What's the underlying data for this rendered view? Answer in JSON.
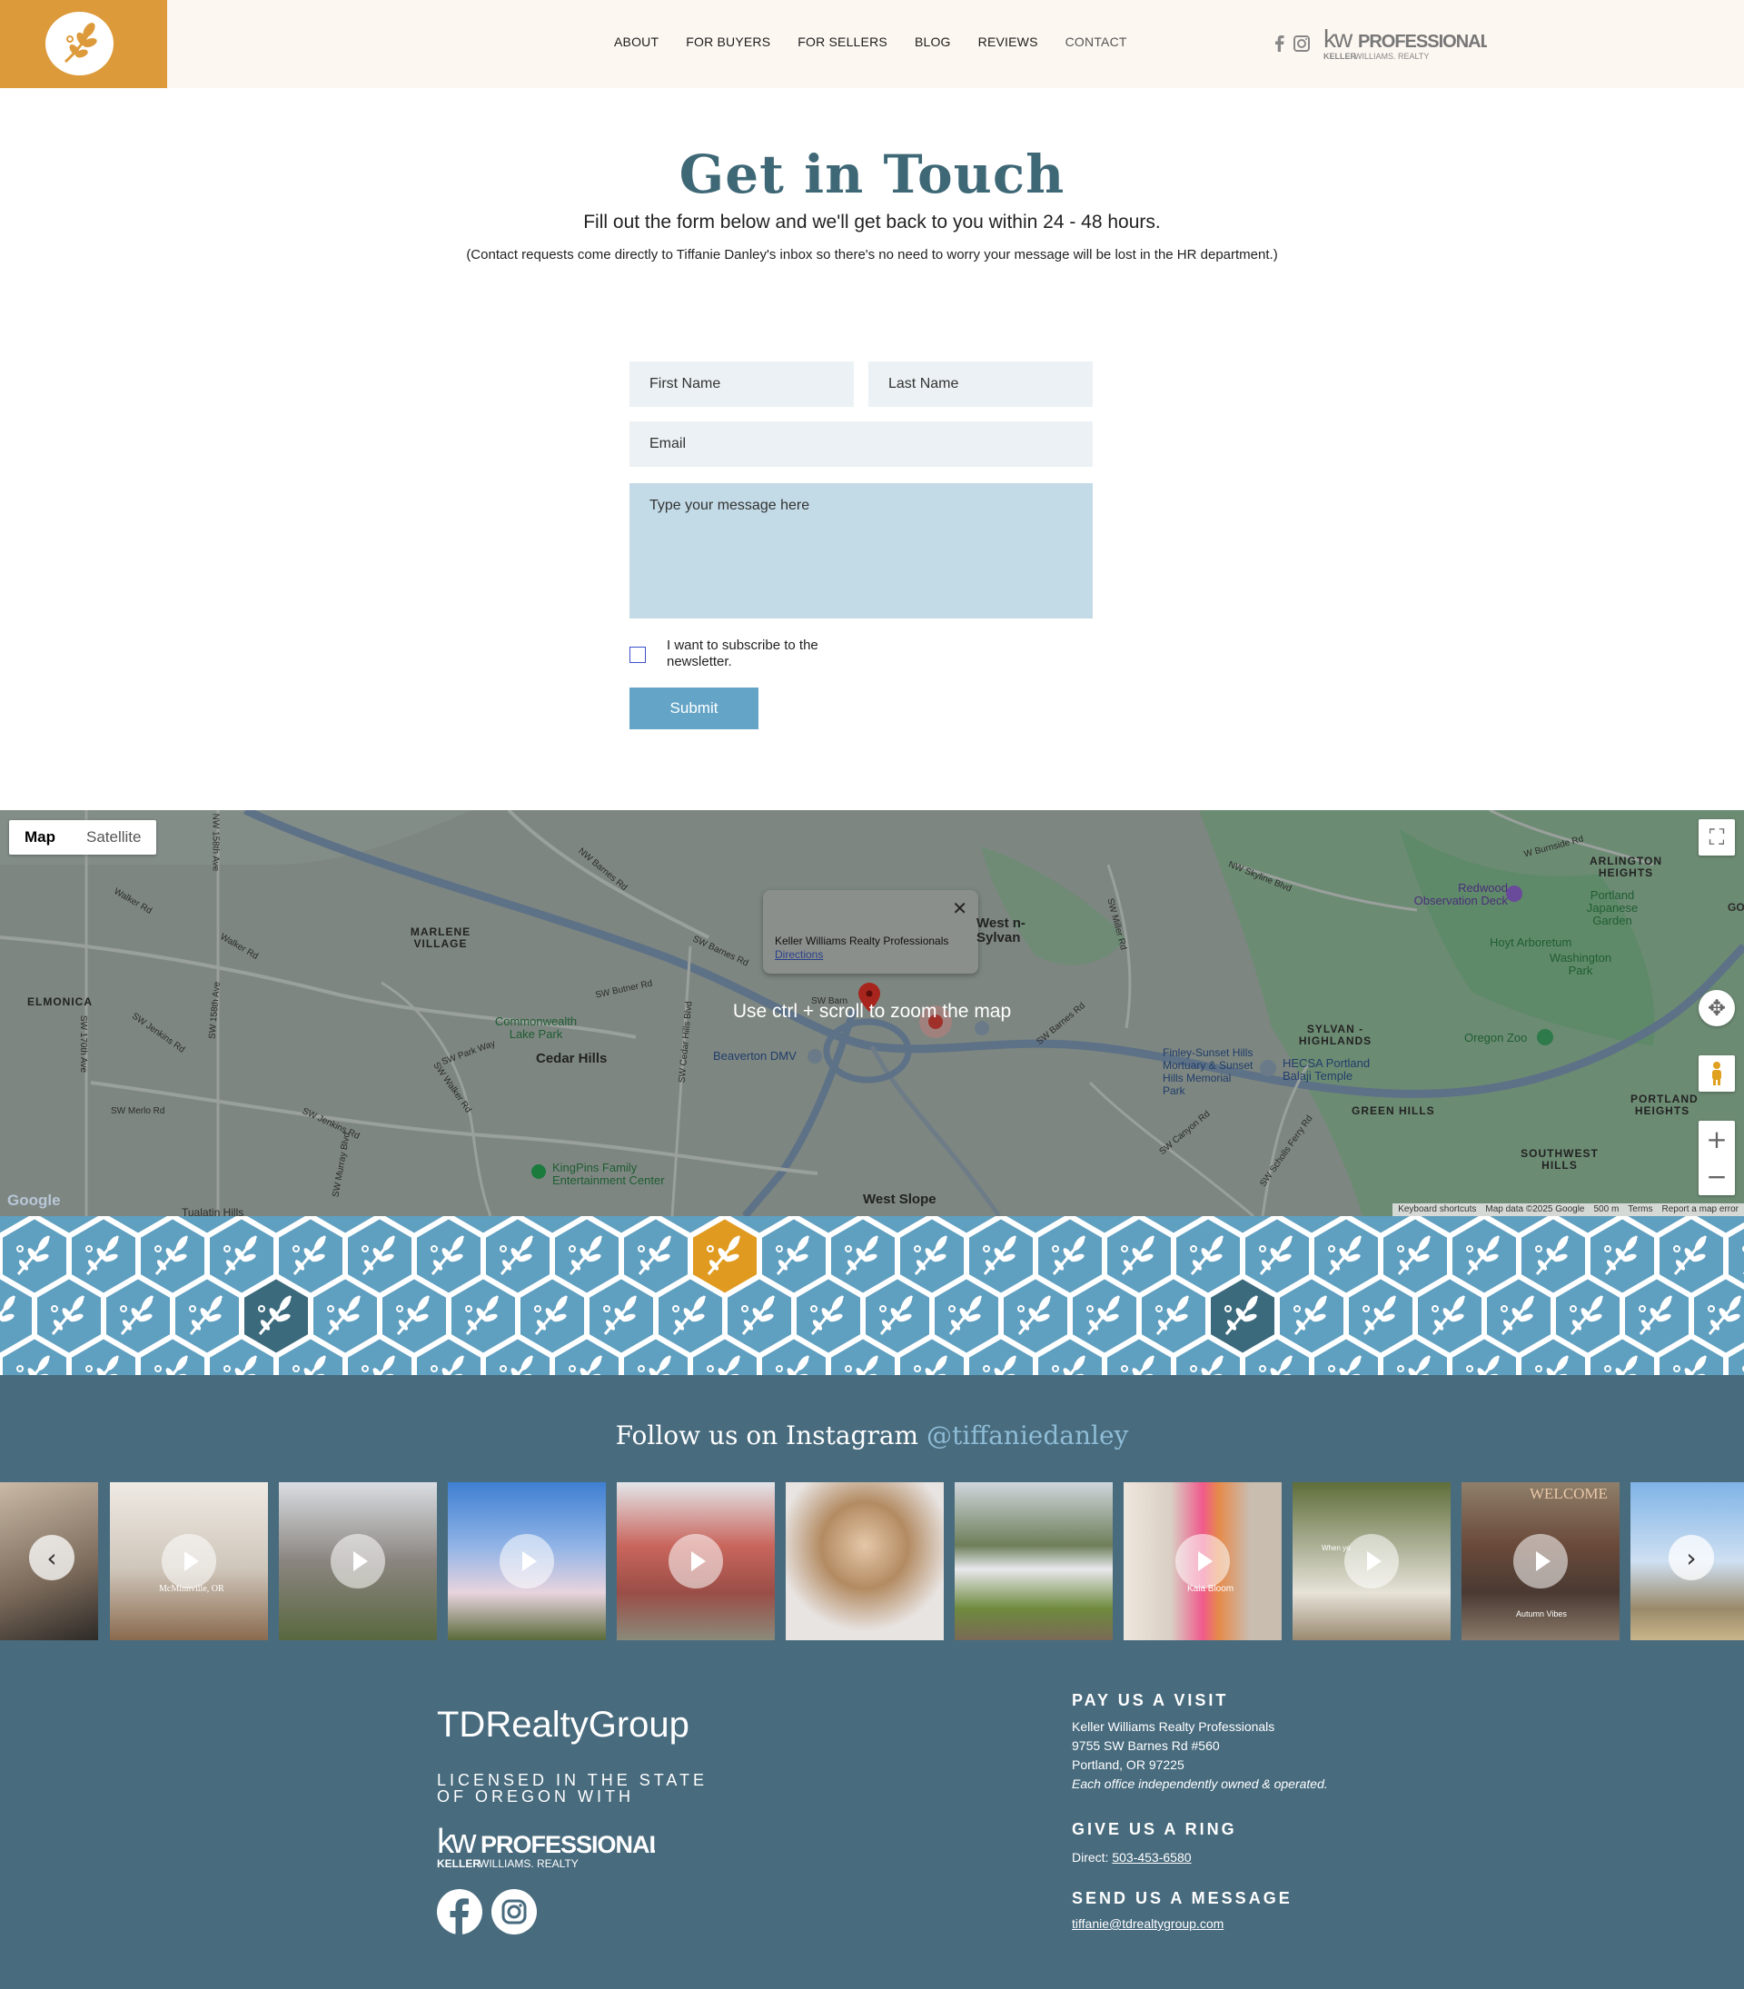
{
  "colors": {
    "accent_gold": "#dd9a3a",
    "title_teal": "#3f6877",
    "footer_bg": "#486b7e",
    "button_blue": "#64a5c7",
    "message_bg": "#c3dbe7"
  },
  "header": {
    "logo_icon": "olive-branch-icon",
    "nav": [
      "ABOUT",
      "FOR BUYERS",
      "FOR SELLERS",
      "BLOG",
      "REVIEWS",
      "CONTACT"
    ],
    "kw": {
      "mark": "kw",
      "name": "PROFESSIONALS",
      "sub_bold": "KELLER",
      "sub_rest": "WILLIAMS. REALTY"
    }
  },
  "contact": {
    "title": "Get in Touch",
    "subtitle": "Fill out the form below and we'll get back to you within 24 - 48 hours.",
    "note": "(Contact requests come directly to Tiffanie Danley's inbox so there's no need to worry your message will be lost in the HR department.)",
    "first_name_placeholder": "First Name",
    "last_name_placeholder": "Last Name",
    "email_placeholder": "Email",
    "message_placeholder": "Type your message here",
    "subscribe_label": "I want to subscribe to the newsletter.",
    "submit_label": "Submit"
  },
  "map": {
    "tab_map": "Map",
    "tab_satellite": "Satellite",
    "info_name": "Keller Williams Realty Professionals",
    "info_directions": "Directions",
    "hint": "Use ctrl + scroll to zoom the map",
    "labels": {
      "marlene": "MARLENE VILLAGE",
      "elmonica": "ELMONICA",
      "commonwealth": "Commonwealth Lake Park",
      "cedar_hills": "Cedar Hills",
      "beaverton_dmv": "Beaverton DMV",
      "west_sylvan": "West n-Sylvan",
      "sylvan_highlands": "SYLVAN - HIGHLANDS",
      "arlington": "ARLINGTON HEIGHTS",
      "redwood": "Redwood Observation Deck",
      "japanese_garden": "Portland Japanese Garden",
      "hoyt": "Hoyt Arboretum",
      "washington_park": "Washington Park",
      "oregon_zoo": "Oregon Zoo",
      "finley": "Finley-Sunset Hills Mortuary & Sunset Hills Memorial Park",
      "hecsa": "HECSA Portland Balaji Temple",
      "green_hills": "GREEN HILLS",
      "portland_heights": "PORTLAND HEIGHTS",
      "southwest_hills": "SOUTHWEST HILLS",
      "kingpins": "KingPins Family Entertainment Center",
      "west_slope": "West Slope",
      "tualatin": "Tualatin Hills",
      "walker_rd": "Walker Rd",
      "sw_barnes": "SW Barnes Rd",
      "nw_barnes": "NW Barnes Rd",
      "sw_butner": "SW Butner Rd",
      "sw_merlo": "SW Merlo Rd",
      "sw_jenkins": "SW Jenkins Rd",
      "sw_park_way": "SW Park Way",
      "nw_skyline": "NW Skyline Blvd",
      "sw_canyon": "SW Canyon Rd",
      "sw_scholls": "SW Scholls Ferry Rd",
      "w_burnside": "W Burnside Rd",
      "sw_170th": "SW 170th Ave",
      "nw_158th": "NW 158th Ave",
      "sw_158th": "SW 158th Ave",
      "sw_cedar_hills": "SW Cedar Hills Blvd",
      "sw_murray": "SW Murray Blvd",
      "sw_miller": "SW Miller Rd",
      "sw_walker": "SW Walker Rd",
      "sw_barn": "SW Barn",
      "go": "GO"
    },
    "google": "Google",
    "footer": [
      "Keyboard shortcuts",
      "Map data ©2025 Google",
      "500 m",
      "Terms",
      "Report a map error"
    ]
  },
  "instagram": {
    "title": "Follow us on Instagram",
    "handle": "@tiffaniedanley",
    "captions": [
      "McMinnville, OR",
      "Kaia Bloom",
      "Autumn Vibes",
      "When yo",
      "WELCOME"
    ]
  },
  "footer": {
    "brand": "TDRealtyGroup",
    "licensed": "LICENSED IN THE STATE OF OREGON WITH",
    "visit_heading": "PAY US A VISIT",
    "visit_name": "Keller Williams Realty Professionals",
    "visit_street": "9755 SW Barnes Rd #560",
    "visit_city": "Portland, OR 97225",
    "visit_note": "Each office independently owned & operated.",
    "ring_heading": "GIVE US A RING",
    "ring_prefix": "Direct: ",
    "ring_phone": "503-453-6580",
    "message_heading": "SEND US A MESSAGE",
    "message_email": "tiffanie@tdrealtygroup.com"
  }
}
